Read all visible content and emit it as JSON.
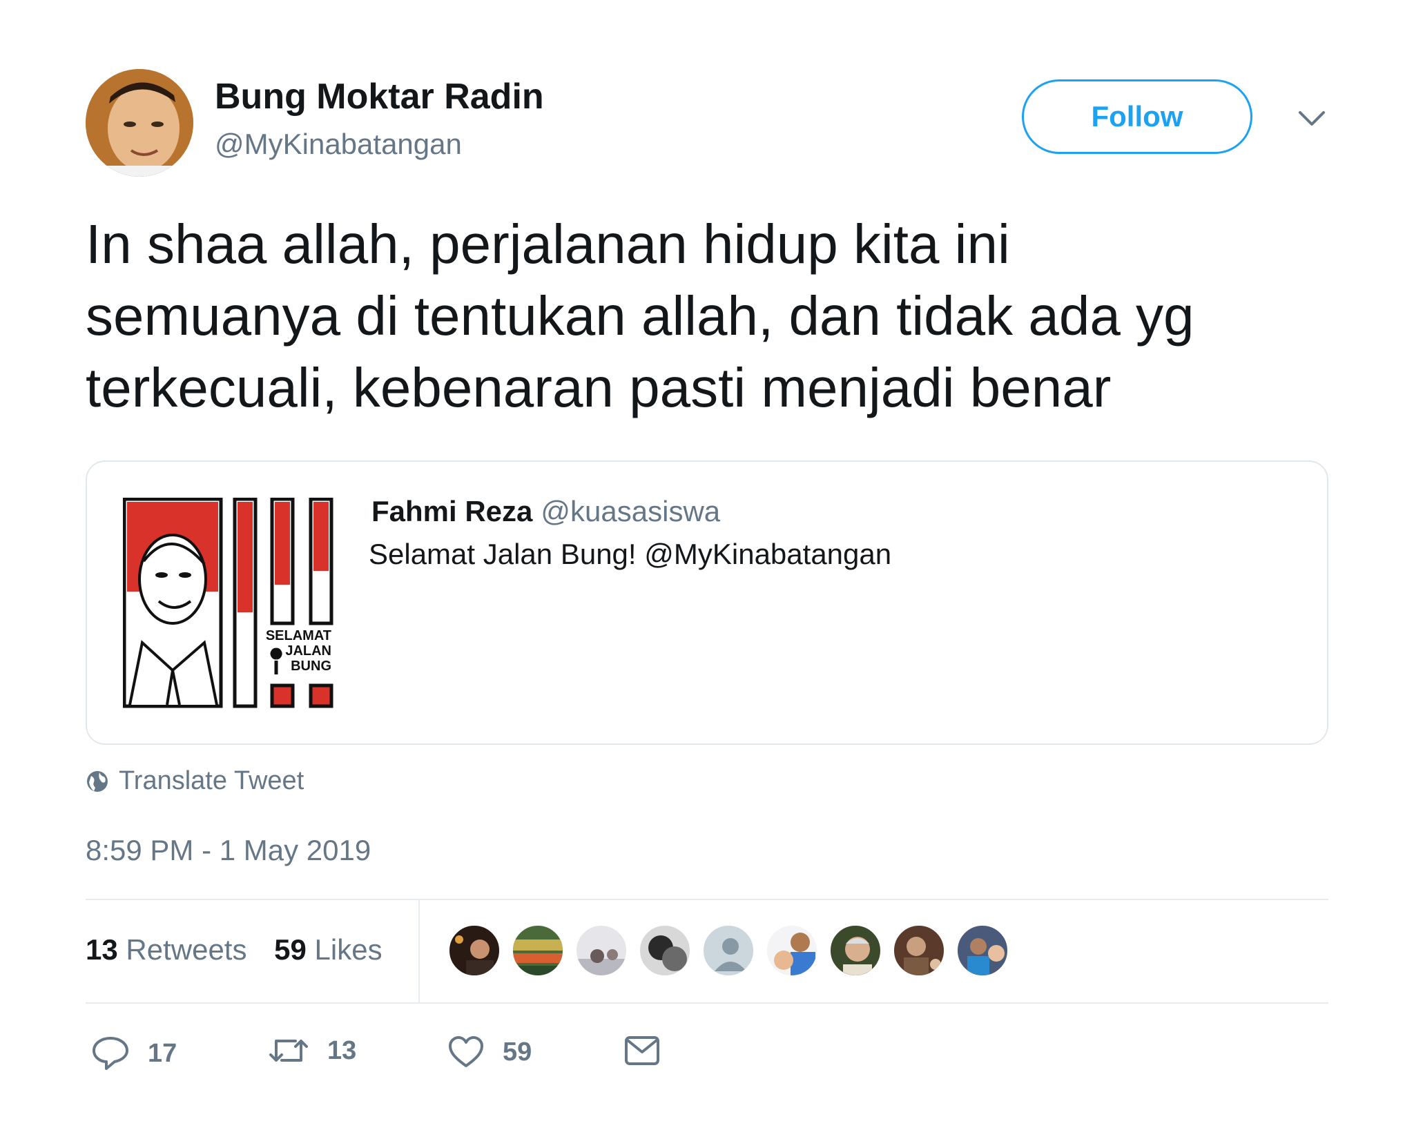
{
  "author": {
    "name": "Bung Moktar Radin",
    "handle": "@MyKinabatangan"
  },
  "header": {
    "follow_label": "Follow"
  },
  "tweet": {
    "text_lines": [
      "In shaa allah, perjalanan hidup kita ini",
      "semuanya di tentukan allah, dan tidak ada yg",
      "terkecuali, kebenaran pasti menjadi benar"
    ],
    "translate_label": "Translate Tweet",
    "timestamp": "8:59 PM - 1 May 2019"
  },
  "quoted_tweet": {
    "name": "Fahmi Reza",
    "handle": "@kuasasiswa",
    "text": "Selamat Jalan Bung! @MyKinabatangan",
    "image_caption": [
      "SELAMAT",
      "JALAN",
      "BUNG"
    ]
  },
  "stats": {
    "retweets_count": "13",
    "retweets_label": "Retweets",
    "likes_count": "59",
    "likes_label": "Likes"
  },
  "likers_count_shown": 9,
  "actions": {
    "reply_count": "17",
    "retweet_count": "13",
    "like_count": "59"
  },
  "colors": {
    "accent": "#1da1f2",
    "secondary_text": "#657786",
    "poster_red": "#d8322b"
  }
}
